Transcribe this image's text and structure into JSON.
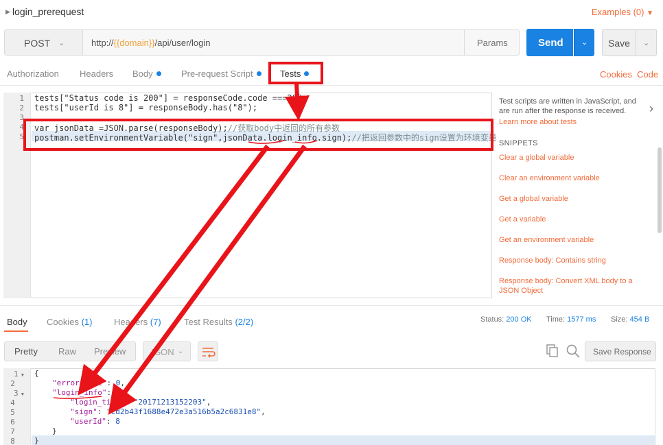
{
  "request": {
    "name": "login_prerequest",
    "examples_label": "Examples (0)",
    "method": "POST",
    "url_prefix": "http://",
    "url_variable": "{{domain}}",
    "url_suffix": "/api/user/login",
    "params_label": "Params",
    "send_label": "Send",
    "save_label": "Save"
  },
  "request_tabs": [
    {
      "label": "Authorization"
    },
    {
      "label": "Headers"
    },
    {
      "label": "Body"
    },
    {
      "label": "Pre-request Script"
    },
    {
      "label": "Tests"
    }
  ],
  "links": {
    "cookies": "Cookies",
    "code": "Code"
  },
  "editor": {
    "line_numbers": [
      "1",
      "2",
      "3",
      "4",
      "5"
    ],
    "lines": {
      "l1": "tests[\"Status code is 200\"] = responseCode.code ===200;",
      "l2": "tests[\"userId is 8\"] = responseBody.has(\"8\");",
      "l4_code": "var jsonData =JSON.parse(responseBody);",
      "l4_comment": "//获取body中返回的所有参数",
      "l5_code": "postman.setEnvironmentVariable(\"sign\",jsonData.login_info.sign);",
      "l5_comment": "//把返回参数中的sign设置为环境变量"
    }
  },
  "sidebar": {
    "description": "Test scripts are written in JavaScript, and are run after the response is received.",
    "learn_more": "Learn more about tests",
    "snippets_title": "SNIPPETS",
    "snippets": [
      "Clear a global variable",
      "Clear an environment variable",
      "Get a global variable",
      "Get a variable",
      "Get an environment variable",
      "Response body: Contains string",
      "Response body: Convert XML body to a JSON Object"
    ]
  },
  "response": {
    "tabs": {
      "body": "Body",
      "cookies": "Cookies",
      "cookies_count": "(1)",
      "headers": "Headers",
      "headers_count": "(7)",
      "tests": "Test Results",
      "tests_count": "(2/2)"
    },
    "status_label": "Status:",
    "status_value": "200 OK",
    "time_label": "Time:",
    "time_value": "1577 ms",
    "size_label": "Size:",
    "size_value": "454 B",
    "views": {
      "pretty": "Pretty",
      "raw": "Raw",
      "preview": "Preview"
    },
    "format": "JSON",
    "save_response": "Save Response",
    "line_numbers": [
      "1",
      "2",
      "3",
      "4",
      "5",
      "6",
      "7",
      "8"
    ],
    "json": {
      "error_code_key": "\"error_code\"",
      "error_code_val": "0",
      "login_info_key": "\"login_info\"",
      "login_time_key": "\"login_time\"",
      "login_time_val": "\"20171213152203\"",
      "sign_key": "\"sign\"",
      "sign_val": "\"cd2b43f1688e472e3a516b5a2c6831e8\"",
      "userid_key": "\"userId\"",
      "userid_val": "8"
    }
  },
  "colors": {
    "accent": "#f26b3a",
    "send": "#1a82e2",
    "annotation": "#e8141a"
  }
}
